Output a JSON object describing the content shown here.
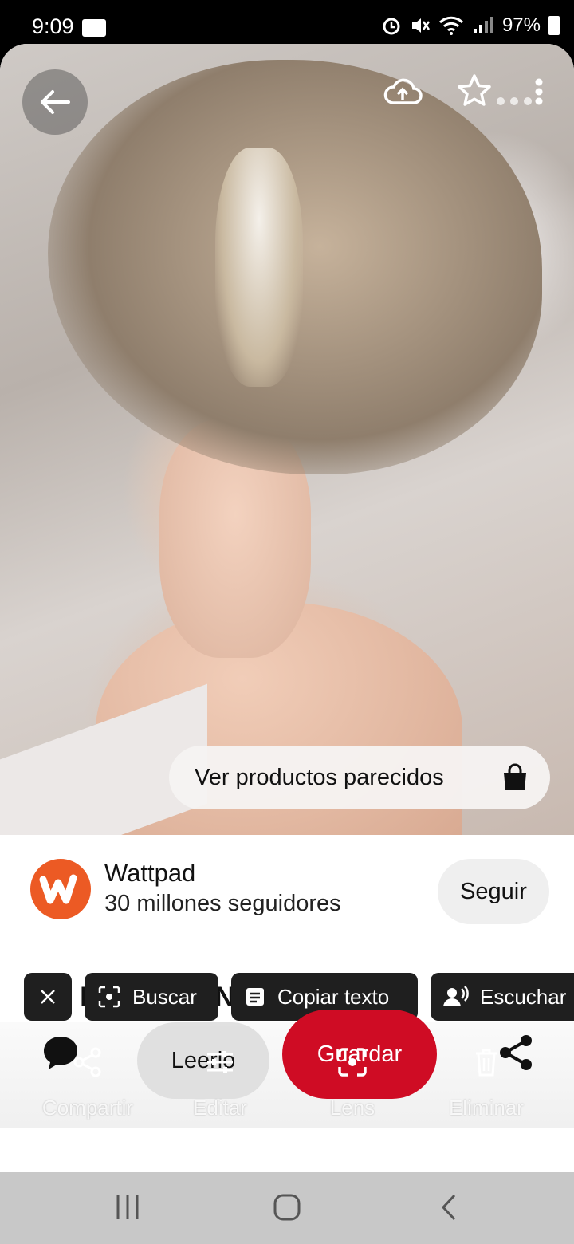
{
  "status_bar": {
    "time": "9:09",
    "battery": "97%"
  },
  "photo": {
    "similar_products_label": "Ver productos parecidos"
  },
  "creator": {
    "name": "Wattpad",
    "followers": "30 millones seguidores",
    "follow_label": "Seguir"
  },
  "pin": {
    "title": "Yes Daddy ✓EN EDICIÓN✓"
  },
  "lens_chips": {
    "search_label": "Buscar",
    "copy_text_label": "Copiar texto",
    "listen_label": "Escuchar"
  },
  "actions": {
    "read_label": "Leerlo",
    "save_label": "Guardar"
  },
  "screenshot_tools": {
    "share_label": "Compartir",
    "edit_label": "Editar",
    "lens_label": "Lens",
    "delete_label": "Eliminar"
  },
  "colors": {
    "save_red": "#cf0c24",
    "wattpad_orange": "#ec5a24"
  }
}
